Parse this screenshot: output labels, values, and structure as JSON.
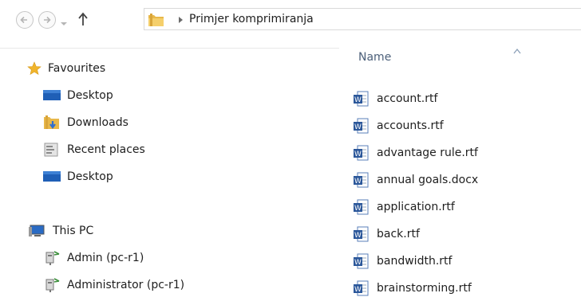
{
  "address": {
    "breadcrumb_label": "Primjer komprimiranja"
  },
  "nav_tree": {
    "favourites": "Favourites",
    "fav_items": [
      "Desktop",
      "Downloads",
      "Recent places",
      "Desktop"
    ],
    "this_pc": "This PC",
    "pc_items": [
      "Admin (pc-r1)",
      "Administrator (pc-r1)"
    ]
  },
  "files": {
    "column_name": "Name",
    "items": [
      "account.rtf",
      "accounts.rtf",
      "advantage rule.rtf",
      "annual goals.docx",
      "application.rtf",
      "back.rtf",
      "bandwidth.rtf",
      "brainstorming.rtf"
    ]
  },
  "colors": {
    "header_text": "#4c607a",
    "folder_yellow": "#e8b84a",
    "word_blue": "#2b579a"
  }
}
